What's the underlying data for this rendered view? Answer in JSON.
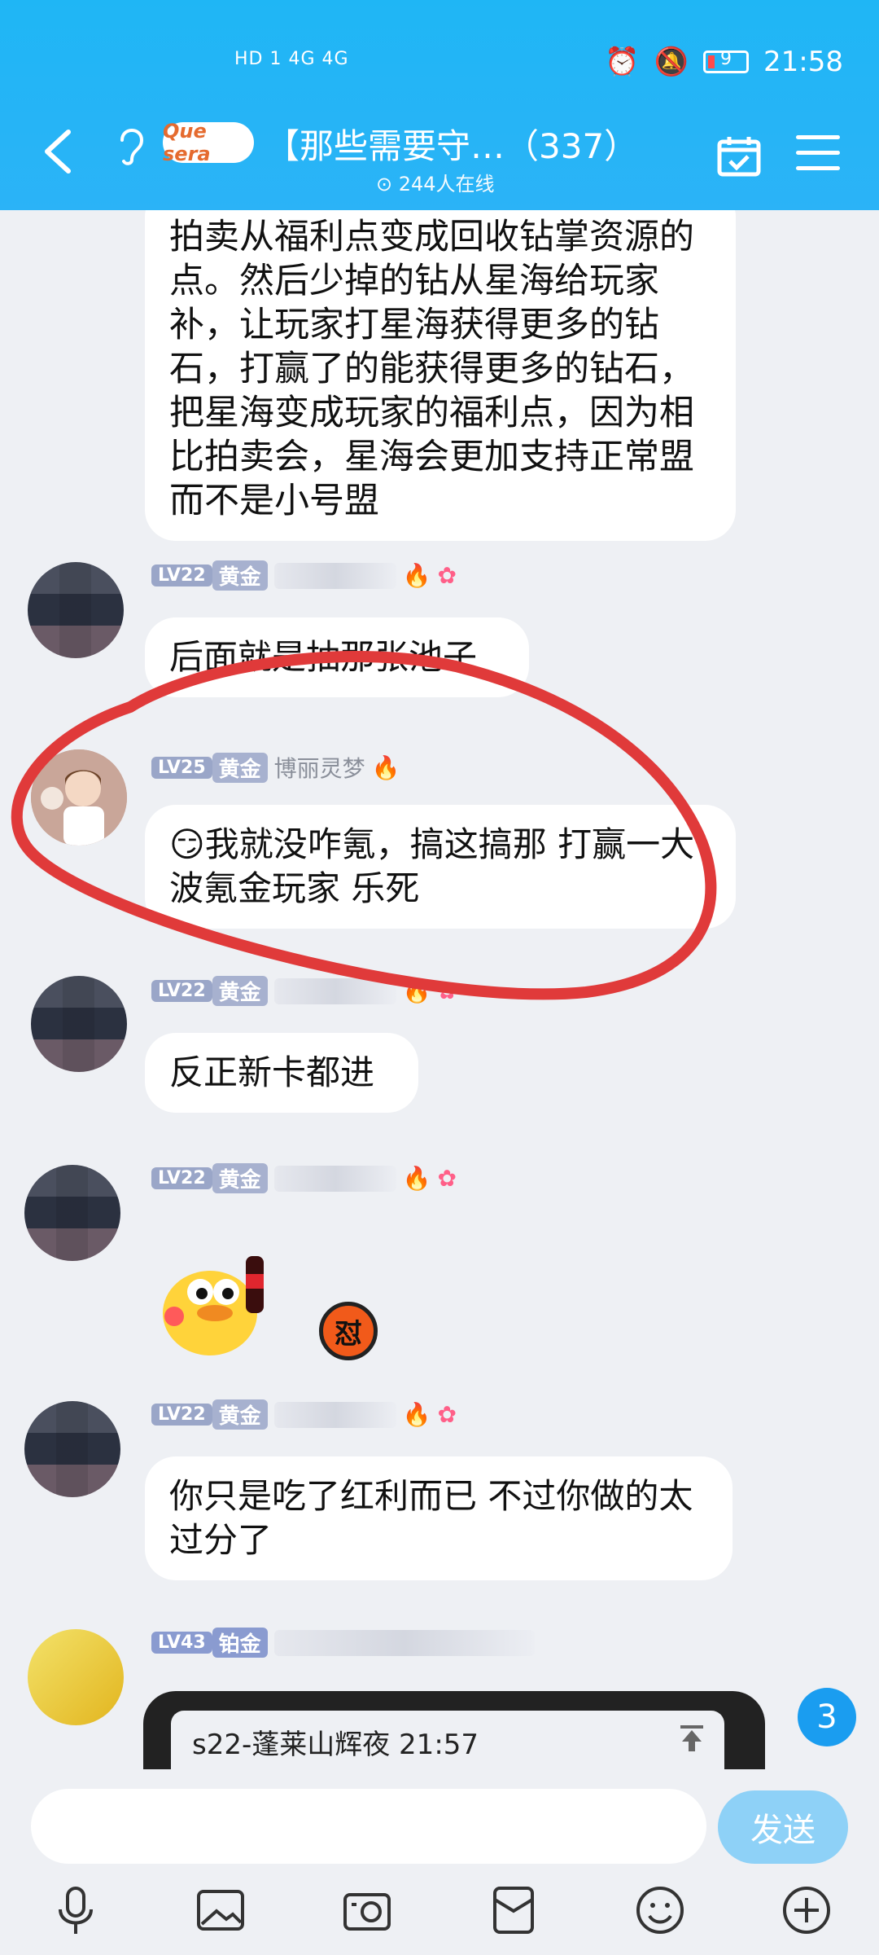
{
  "status_bar": {
    "network": "HD 1  4G  4G",
    "battery": "9",
    "time": "21:58"
  },
  "header": {
    "logo_text": "Que sera",
    "title": "【那些需要守…（337）",
    "online": "244人在线"
  },
  "messages": [
    {
      "text": "拍卖从福利点变成回收钻掌资源的点。然后少掉的钻从星海给玩家补，让玩家打星海获得更多的钻石，打赢了的能获得更多的钻石，把星海变成玩家的福利点，因为相比拍卖会，星海会更加支持正常盟而不是小号盟"
    },
    {
      "level": "LV22",
      "rank": "黄金",
      "text": "后面就是抽那张池子"
    },
    {
      "level": "LV25",
      "rank": "黄金",
      "name": "博丽灵梦",
      "emoji": "😏",
      "text": "我就没咋氪，搞这搞那 打赢一大波氪金玩家 乐死"
    },
    {
      "level": "LV22",
      "rank": "黄金",
      "text": "反正新卡都进"
    },
    {
      "level": "LV22",
      "rank": "黄金",
      "sticker_stamp": "怼"
    },
    {
      "level": "LV22",
      "rank": "黄金",
      "text": "你只是吃了红利而已 不过你做的太过分了"
    },
    {
      "level": "LV43",
      "rank": "铂金"
    }
  ],
  "pinned": {
    "text": "s22-蓬莱山辉夜 21:57"
  },
  "unread_badge": "3",
  "input": {
    "placeholder": "",
    "send_label": "发送"
  },
  "colors": {
    "header": "#2bb3f7",
    "annotation": "#e03a3a",
    "send": "#8ed1f7"
  }
}
